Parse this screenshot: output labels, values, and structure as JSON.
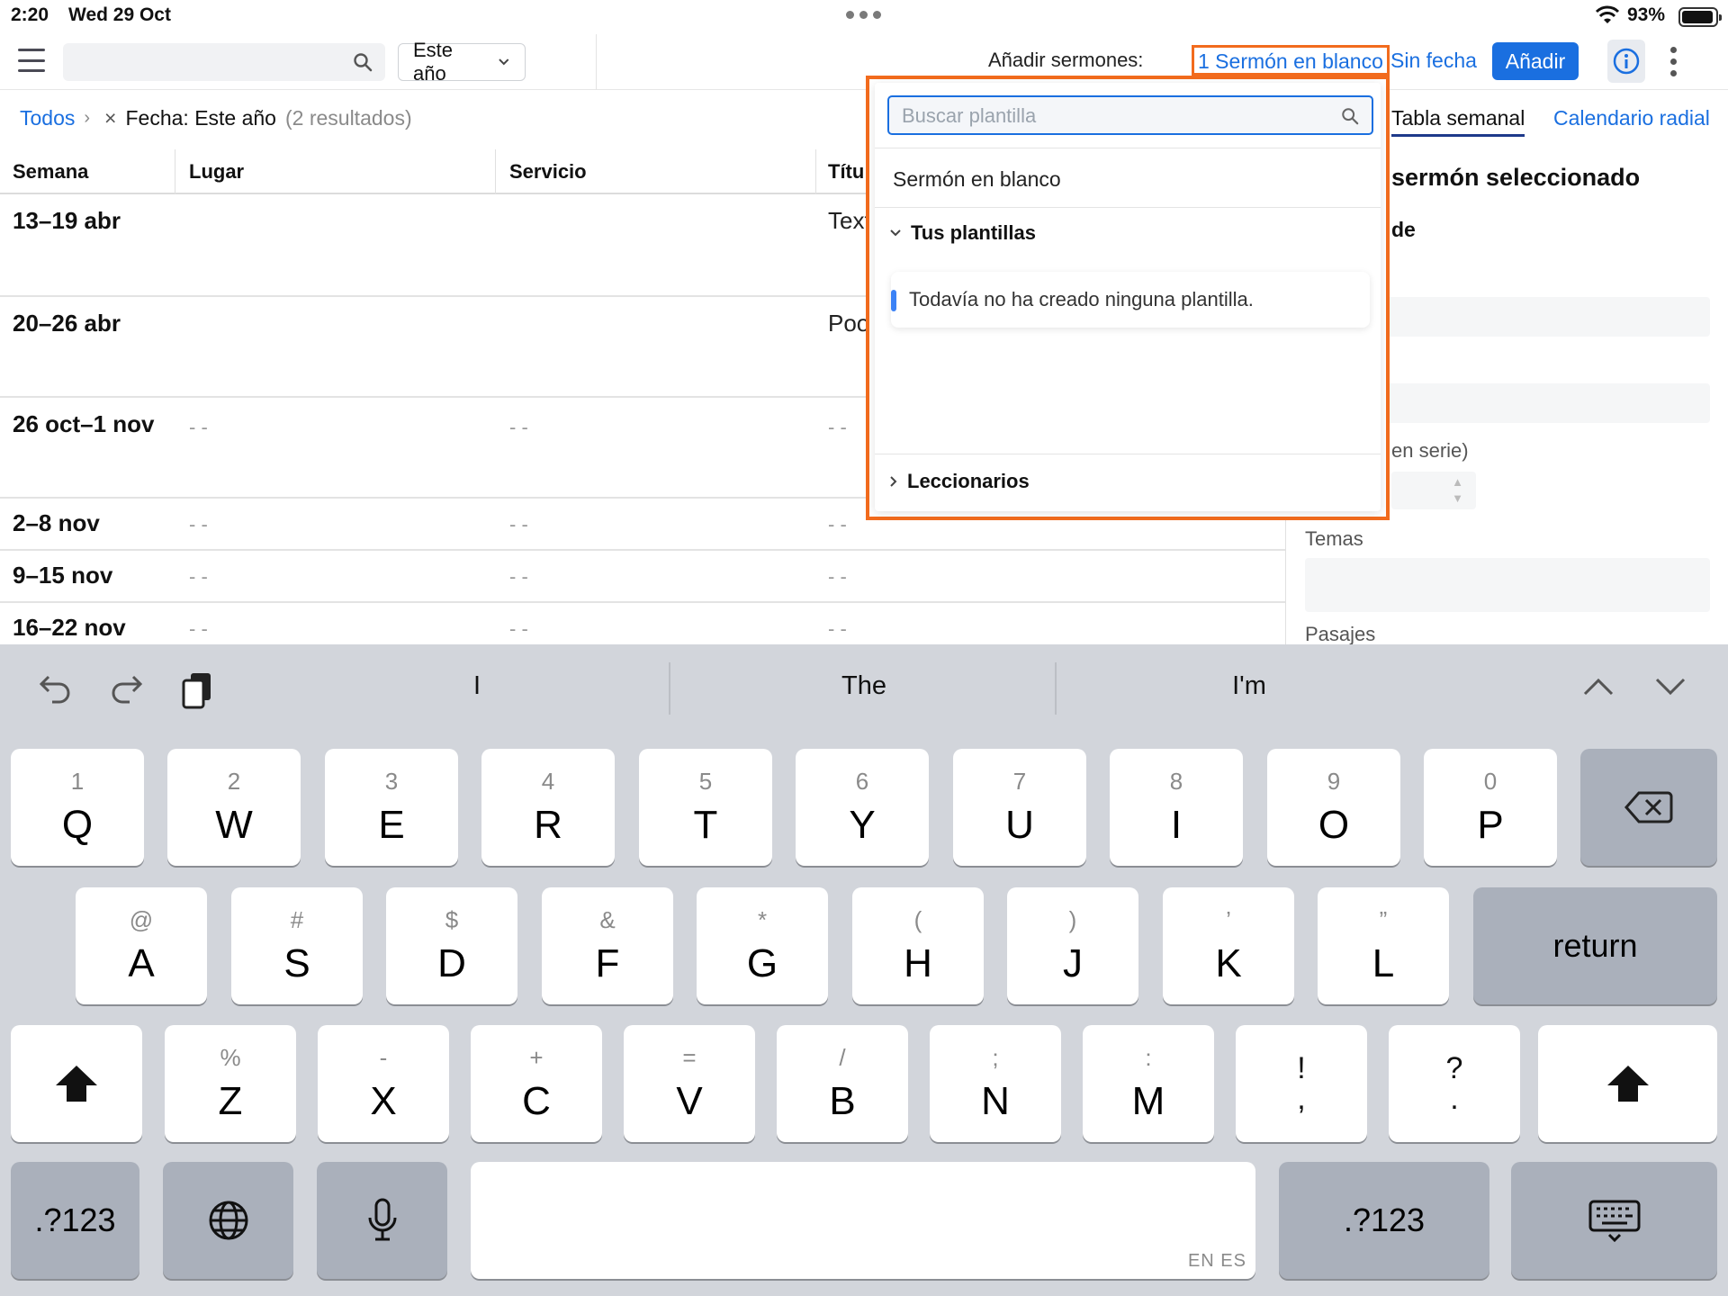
{
  "status_bar": {
    "time": "2:20",
    "date": "Wed 29 Oct",
    "battery": "93%"
  },
  "toolbar": {
    "search_value": "",
    "year_select": "Este año",
    "add_label": "Añadir sermones:",
    "blank_link": "1 Sermón en blanco",
    "nodate_link": "Sin fecha",
    "add_button": "Añadir"
  },
  "breadcrumb": {
    "all": "Todos",
    "filter": "Fecha: Este año",
    "count": "(2 resultados)"
  },
  "view_tabs": {
    "weekly": "Tabla semanal",
    "radial": "Calendario radial"
  },
  "table": {
    "headers": [
      "Semana",
      "Lugar",
      "Servicio",
      "Títu"
    ],
    "rows": [
      {
        "week": "13–19 abr",
        "lugar": "",
        "servicio": "",
        "titulo": "Text"
      },
      {
        "week": "20–26 abr",
        "lugar": "",
        "servicio": "",
        "titulo": "Poo"
      },
      {
        "week": "26 oct–1 nov",
        "lugar": "- -",
        "servicio": "- -",
        "titulo": "- -"
      },
      {
        "week": "2–8 nov",
        "lugar": "- -",
        "servicio": "- -",
        "titulo": "- -"
      },
      {
        "week": "9–15 nov",
        "lugar": "- -",
        "servicio": "- -",
        "titulo": "- -"
      },
      {
        "week": "16–22 nov",
        "lugar": "- -",
        "servicio": "- -",
        "titulo": "- -"
      }
    ]
  },
  "panel": {
    "title": "sermón seleccionado",
    "subtitle": "de",
    "serie_label": "en serie)",
    "themes_label": "Temas",
    "passages_label": "Pasajes"
  },
  "popover": {
    "search_placeholder": "Buscar plantilla",
    "blank_item": "Sermón en blanco",
    "your_templates": "Tus plantillas",
    "empty_message": "Todavía no ha creado ninguna plantilla.",
    "lectionaries": "Leccionarios"
  },
  "keyboard": {
    "suggestions": [
      "I",
      "The",
      "I'm"
    ],
    "row1": [
      {
        "hint": "1",
        "key": "Q"
      },
      {
        "hint": "2",
        "key": "W"
      },
      {
        "hint": "3",
        "key": "E"
      },
      {
        "hint": "4",
        "key": "R"
      },
      {
        "hint": "5",
        "key": "T"
      },
      {
        "hint": "6",
        "key": "Y"
      },
      {
        "hint": "7",
        "key": "U"
      },
      {
        "hint": "8",
        "key": "I"
      },
      {
        "hint": "9",
        "key": "O"
      },
      {
        "hint": "0",
        "key": "P"
      }
    ],
    "row2": [
      {
        "hint": "@",
        "key": "A"
      },
      {
        "hint": "#",
        "key": "S"
      },
      {
        "hint": "$",
        "key": "D"
      },
      {
        "hint": "&",
        "key": "F"
      },
      {
        "hint": "*",
        "key": "G"
      },
      {
        "hint": "(",
        "key": "H"
      },
      {
        "hint": ")",
        "key": "J"
      },
      {
        "hint": "’",
        "key": "K"
      },
      {
        "hint": "”",
        "key": "L"
      }
    ],
    "row3": [
      {
        "hint": "%",
        "key": "Z"
      },
      {
        "hint": "-",
        "key": "X"
      },
      {
        "hint": "+",
        "key": "C"
      },
      {
        "hint": "=",
        "key": "V"
      },
      {
        "hint": "/",
        "key": "B"
      },
      {
        "hint": ";",
        "key": "N"
      },
      {
        "hint": ":",
        "key": "M"
      }
    ],
    "punct1": {
      "top": "!",
      "bottom": ","
    },
    "punct2": {
      "top": "?",
      "bottom": "."
    },
    "return_label": "return",
    "numbers_label": ".?123",
    "space_lang": "EN ES"
  }
}
